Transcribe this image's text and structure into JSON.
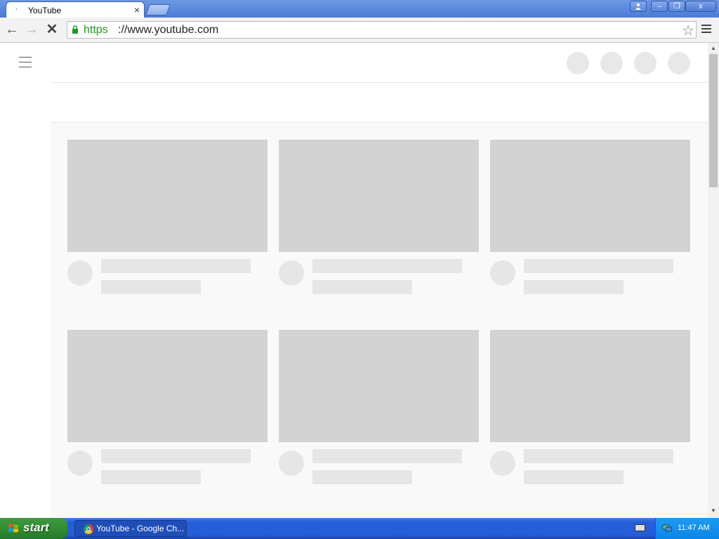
{
  "browser": {
    "tab_title": "YouTube",
    "tab_favicon": "loading-favicon-icon",
    "tab_close": "×",
    "url_scheme": "https",
    "url_rest": "://www.youtube.com",
    "icons": [
      "back-arrow-icon",
      "forward-arrow-icon",
      "stop-icon",
      "lock-icon",
      "star-icon",
      "menu-icon"
    ]
  },
  "window_controls": {
    "minimize": "–",
    "restore": "❐",
    "close": "x"
  },
  "page": {
    "loading": true,
    "placeholder_cards": 6
  },
  "taskbar": {
    "start_label": "start",
    "task_label": "YouTube - Google Ch...",
    "clock": "11:47 AM"
  },
  "colors": {
    "https_green": "#1a9b1a",
    "skeleton_thumb": "#d3d3d3",
    "skeleton_text": "#e6e6e6",
    "taskbar_blue": "#245edb",
    "start_green": "#308a30"
  }
}
